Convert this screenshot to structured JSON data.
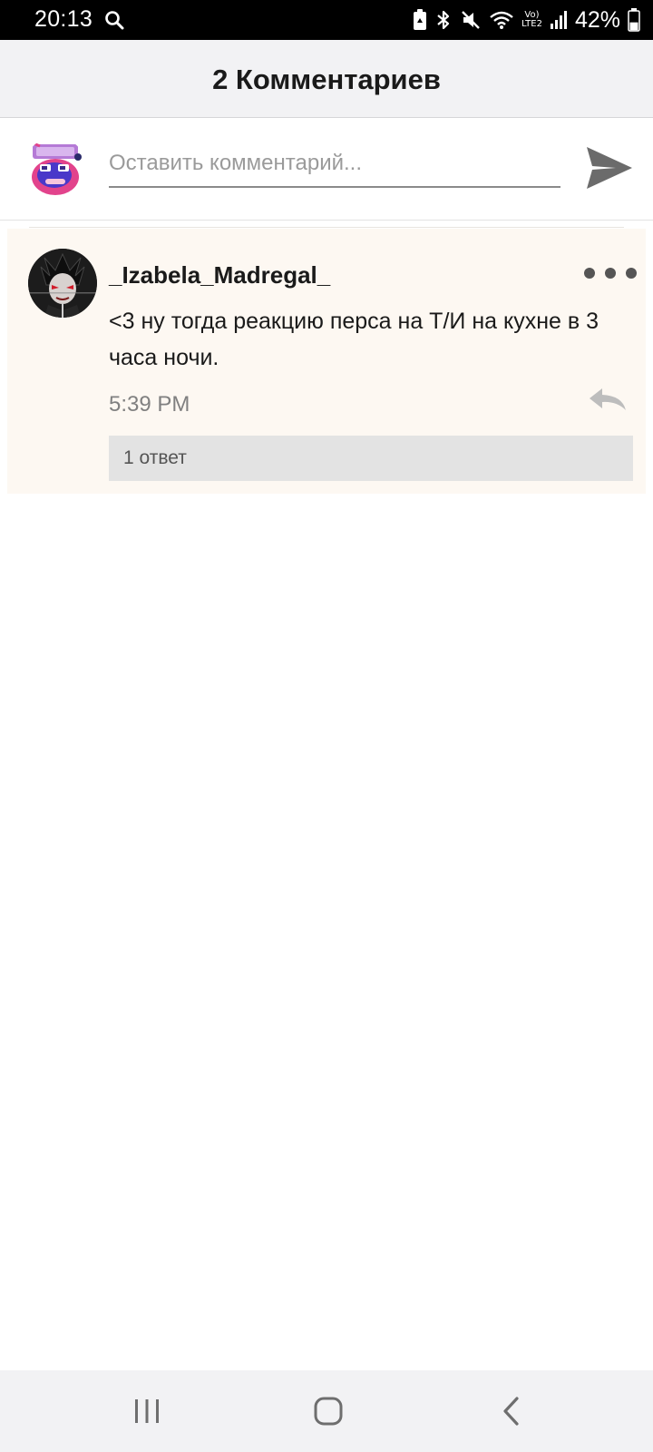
{
  "status_bar": {
    "time": "20:13",
    "network_type": "LTE2",
    "network_prefix": "Vo)",
    "battery_percent": "42%",
    "battery_level": 0.42,
    "icons": [
      "search-icon",
      "battery-saver-icon",
      "bluetooth-icon",
      "mute-icon",
      "wifi-icon",
      "signal-icon",
      "battery-icon"
    ]
  },
  "header": {
    "title": "2 Комментариев"
  },
  "composer": {
    "placeholder": "Оставить комментарий...",
    "value": "",
    "send_icon": "send-icon"
  },
  "comments": [
    {
      "author": "_Izabela_Madregal_",
      "text": "<3 ну тогда реакцию перса на Т/И на кухне в 3 часа ночи.",
      "time": "5:39 PM",
      "replies_label": "1 ответ",
      "more_icon": "more-dots-icon",
      "reply_icon": "reply-icon"
    }
  ],
  "nav_bar": {
    "icons": [
      "recent-apps-icon",
      "home-icon",
      "back-icon"
    ]
  },
  "colors": {
    "card_background": "#fdf8f2",
    "header_background": "#f2f2f4",
    "send_icon": "#6b6b6b",
    "replies_background": "#e3e3e3"
  }
}
